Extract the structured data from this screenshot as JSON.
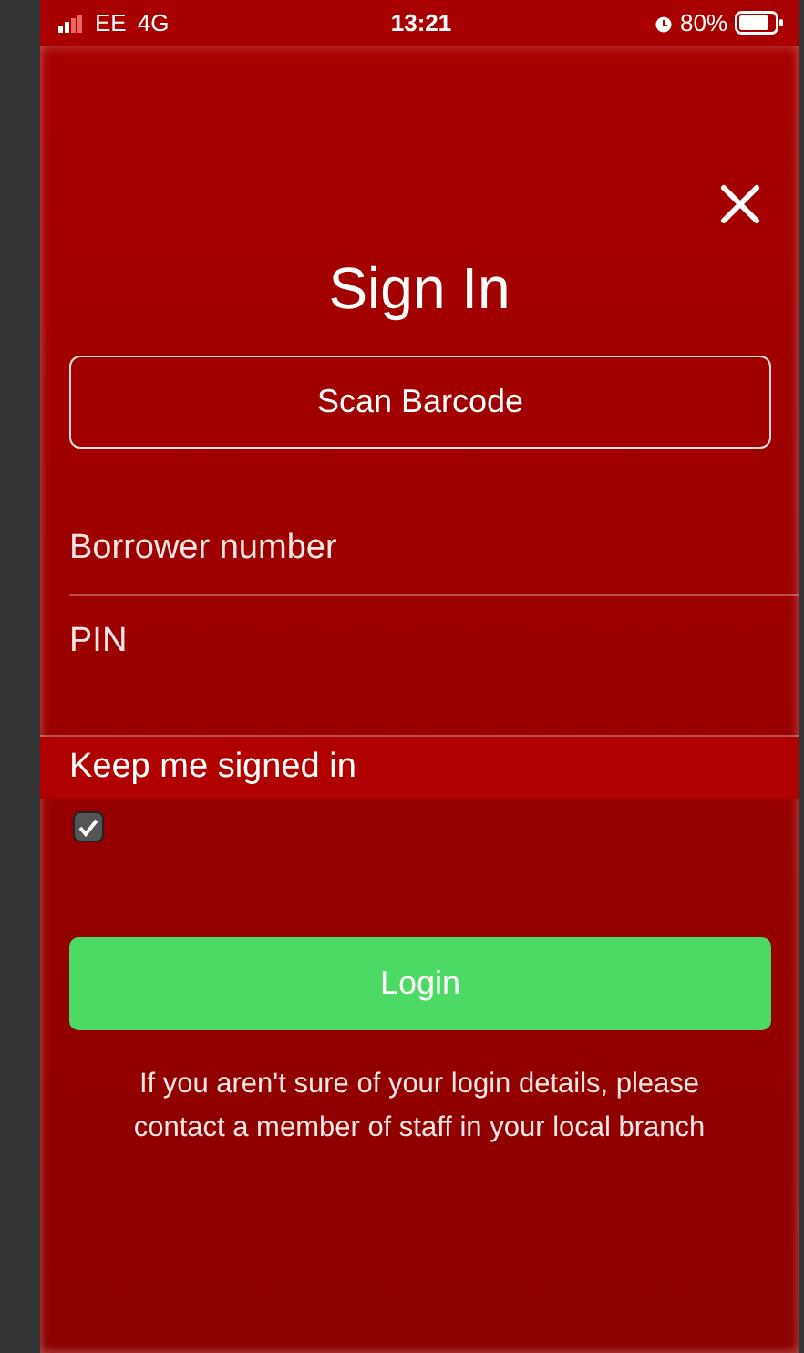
{
  "status_bar": {
    "carrier": "EE",
    "network": "4G",
    "time": "13:21",
    "battery": "80%"
  },
  "dialog": {
    "title": "Sign In",
    "scan_button": "Scan Barcode",
    "fields": [
      {
        "placeholder": "Borrower number"
      },
      {
        "placeholder": "PIN"
      }
    ],
    "keep_signed_in": {
      "label": "Keep me signed in",
      "checked": true
    },
    "login_button": "Login",
    "help_text": "If you aren't sure of your login details, please contact a member of staff in your local branch"
  }
}
